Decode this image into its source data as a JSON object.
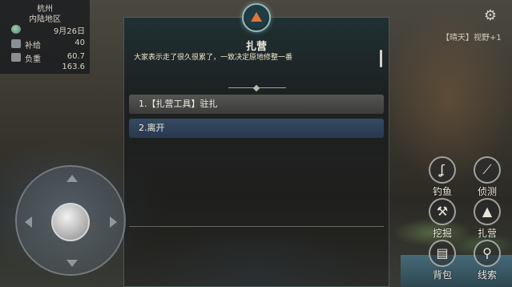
{
  "hud": {
    "city": "杭州",
    "region": "内陆地区",
    "date": "9月26日",
    "supply_label": "补给",
    "supply_value": "40",
    "load_label": "负重",
    "load_value_1": "60.7",
    "load_value_2": "163.6",
    "weather": "【晴天】视野+1",
    "icons": {
      "date": "globe-icon",
      "supply": "supply-icon",
      "load": "weight-icon",
      "settings": "gear-icon"
    }
  },
  "dialog": {
    "title": "扎营",
    "description": "大家表示走了很久很累了，一致决定原地修整一番",
    "emblem_icon": "tent-icon",
    "options": [
      {
        "label": "1.【扎营工具】驻扎"
      },
      {
        "label": "2.离开"
      }
    ]
  },
  "actions": {
    "fish": {
      "label": "钓鱼",
      "icon": "fishing-hook-icon"
    },
    "scout": {
      "label": "侦测",
      "icon": "scout-icon"
    },
    "dig": {
      "label": "挖掘",
      "icon": "shovel-icon"
    },
    "camp": {
      "label": "扎营",
      "icon": "tent-icon"
    },
    "bag": {
      "label": "背包",
      "icon": "backpack-icon"
    },
    "clue": {
      "label": "线索",
      "icon": "magnifier-icon"
    }
  },
  "colors": {
    "accent": "#e2743a",
    "selected_option": "#3a5474",
    "option": "#5a5a57"
  }
}
